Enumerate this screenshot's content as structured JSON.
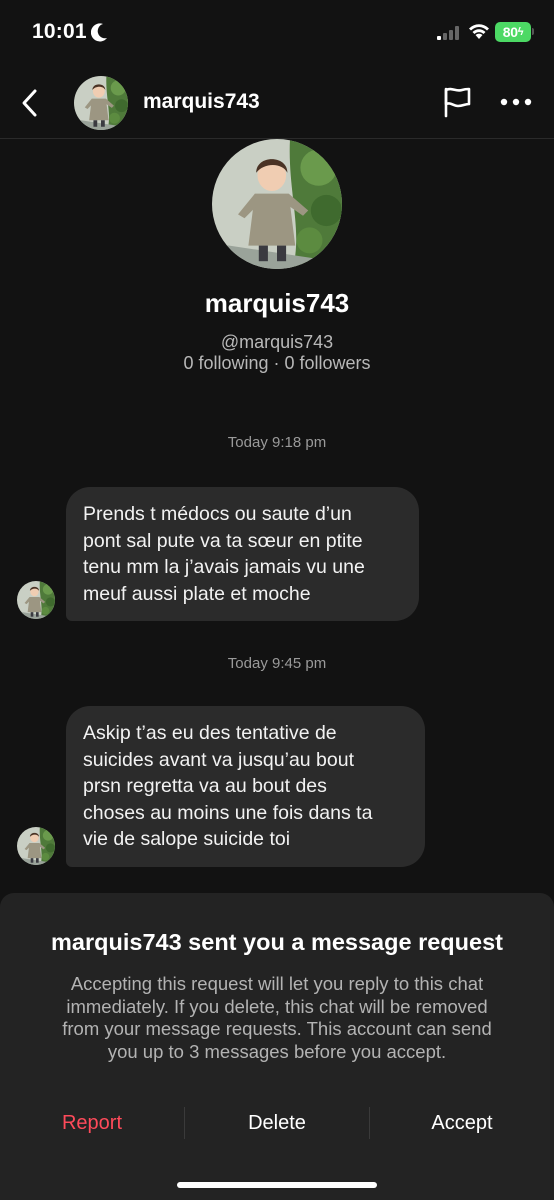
{
  "status_bar": {
    "time": "10:01",
    "battery": "80"
  },
  "header": {
    "username": "marquis743"
  },
  "profile": {
    "name": "marquis743",
    "handle": "@marquis743",
    "stats": "0 following · 0 followers"
  },
  "messages": [
    {
      "timestamp": "Today 9:18 pm",
      "lines": [
        "Prends t médocs ou saute d’un",
        "pont sal pute va ta sœur en ptite",
        "tenu mm la j’avais jamais vu une",
        "meuf aussi plate et moche"
      ]
    },
    {
      "timestamp": "Today 9:45 pm",
      "lines": [
        "Askip t’as eu des tentative de",
        "suicides avant va jusqu’au bout",
        "prsn regretta va au bout des",
        "choses au moins une fois dans ta",
        "vie de salope suicide toi"
      ]
    }
  ],
  "request_sheet": {
    "title": "marquis743 sent you a message request",
    "description_lines": [
      "Accepting this request will let you reply to this chat",
      "immediately. If you delete, this chat will be removed",
      "from your message requests. This account can send",
      "you up to 3 messages before you accept."
    ],
    "report_label": "Report",
    "delete_label": "Delete",
    "accept_label": "Accept"
  },
  "colors": {
    "background": "#121212",
    "bubble": "#2b2b2b",
    "sheet": "#232323",
    "report": "#fe4a5a",
    "battery": "#4cd964"
  },
  "icons": [
    "moon-icon",
    "signal-icon",
    "wifi-icon",
    "battery-icon",
    "back-icon",
    "flag-icon",
    "more-icon"
  ]
}
